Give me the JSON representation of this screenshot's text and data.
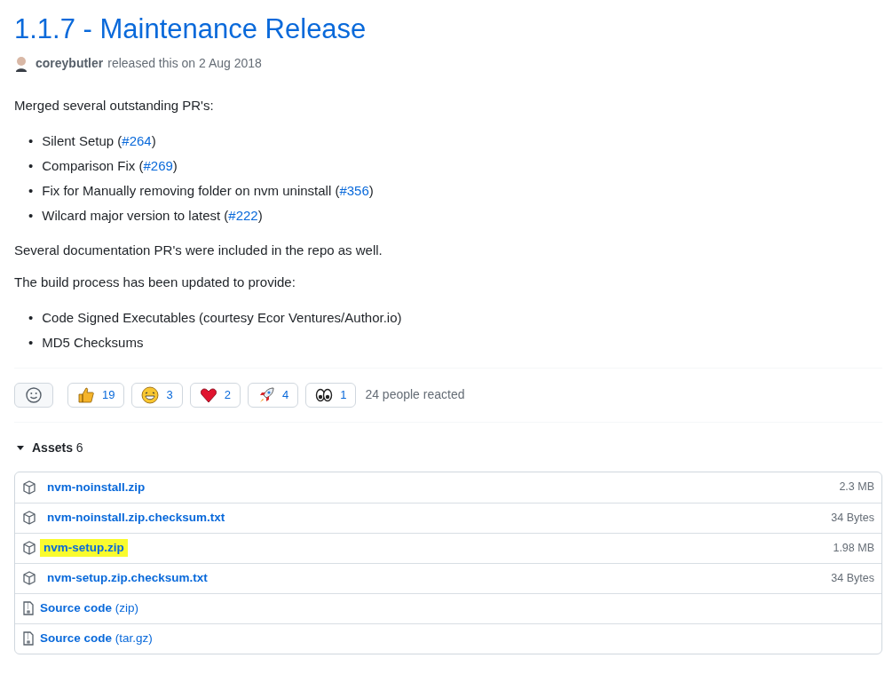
{
  "release": {
    "title": "1.1.7 - Maintenance Release",
    "author": "coreybutler",
    "meta": "released this on 2 Aug 2018"
  },
  "body": [
    {
      "kind": "paragraph",
      "text": "Merged several outstanding PR's:"
    },
    {
      "kind": "list",
      "items": [
        {
          "marker": "•",
          "text": "Silent Setup (",
          "link": "#264",
          "after": ")"
        },
        {
          "marker": "•",
          "text": "Comparison Fix (",
          "link": "#269",
          "after": ")"
        },
        {
          "marker": "•",
          "text": "Fix for Manually removing folder on nvm uninstall (",
          "link": "#356",
          "after": ")"
        },
        {
          "marker": "•",
          "text": "Wilcard major version to latest (",
          "link": "#222",
          "after": ")"
        }
      ]
    },
    {
      "kind": "paragraph",
      "text": "Several documentation PR's were included in the repo as well."
    },
    {
      "kind": "paragraph",
      "text": "The build process has been updated to provide:"
    },
    {
      "kind": "list",
      "items": [
        {
          "marker": "•",
          "text": "Code Signed Executables (courtesy Ecor Ventures/Author.io)"
        },
        {
          "marker": "•",
          "text": "MD5 Checksums"
        }
      ]
    }
  ],
  "reactions": [
    {
      "kind": "thumbs-up",
      "count": "19"
    },
    {
      "kind": "laugh",
      "count": "3"
    },
    {
      "kind": "heart",
      "count": "2"
    },
    {
      "kind": "rocket",
      "count": "4"
    },
    {
      "kind": "eyes",
      "count": "1"
    }
  ],
  "reactions_summary": "24 people reacted",
  "assets": {
    "label": "Assets",
    "count": "6",
    "expanded": true,
    "items": [
      {
        "kind": "package",
        "name": "nvm-noinstall.zip",
        "size": "2.3 MB",
        "highlighted": false
      },
      {
        "kind": "package",
        "name": "nvm-noinstall.zip.checksum.txt",
        "size": "34 Bytes",
        "highlighted": false
      },
      {
        "kind": "package",
        "name": "nvm-setup.zip",
        "size": "1.98 MB",
        "highlighted": true
      },
      {
        "kind": "package",
        "name": "nvm-setup.zip.checksum.txt",
        "size": "34 Bytes",
        "highlighted": false
      },
      {
        "kind": "source",
        "name": "Source code",
        "suffix": "(zip)"
      },
      {
        "kind": "source",
        "name": "Source code",
        "suffix": "(tar.gz)"
      }
    ]
  }
}
